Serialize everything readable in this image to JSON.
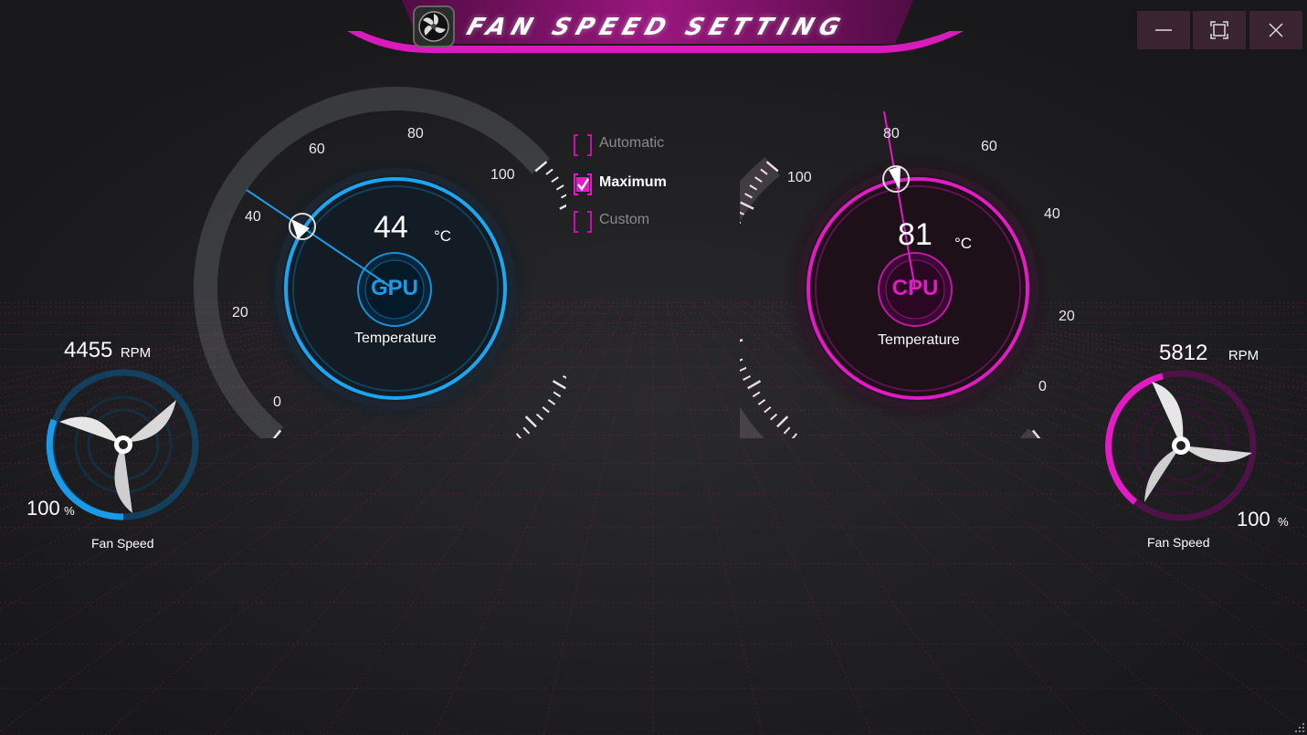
{
  "header": {
    "title": "FAN SPEED SETTING"
  },
  "window_controls": {
    "minimize": "—",
    "maximize": "□",
    "close": "X"
  },
  "modes": {
    "automatic": {
      "label": "Automatic",
      "checked": false
    },
    "maximum": {
      "label": "Maximum",
      "checked": true
    },
    "custom": {
      "label": "Custom",
      "checked": false
    }
  },
  "gpu": {
    "badge": "GPU",
    "temperature": "44",
    "temp_unit": "°C",
    "temp_label": "Temperature",
    "scale_labels": [
      "0",
      "20",
      "40",
      "60",
      "80",
      "100"
    ],
    "fan_rpm": "4455",
    "rpm_unit": "RPM",
    "fan_percent": "100",
    "percent_unit": "%",
    "fan_label": "Fan Speed",
    "accent": "#1a9be8"
  },
  "cpu": {
    "badge": "CPU",
    "temperature": "81",
    "temp_unit": "°C",
    "temp_label": "Temperature",
    "scale_labels": [
      "0",
      "20",
      "40",
      "60",
      "80",
      "100"
    ],
    "fan_rpm": "5812",
    "rpm_unit": "RPM",
    "fan_percent": "100",
    "percent_unit": "%",
    "fan_label": "Fan Speed",
    "accent": "#e21bc4"
  }
}
